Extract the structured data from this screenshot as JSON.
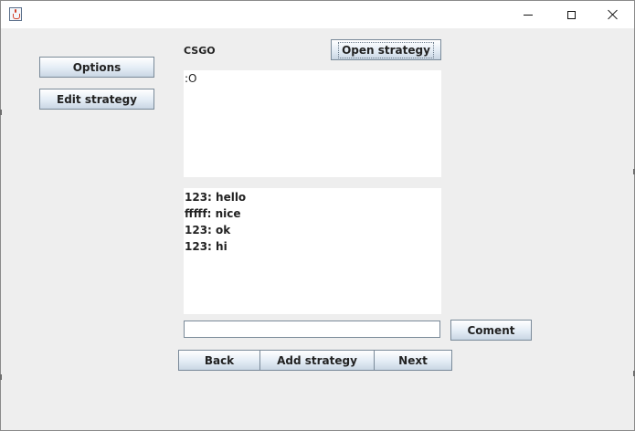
{
  "window": {
    "title": "",
    "controls": {
      "minimize": "minimize",
      "maximize": "maximize",
      "close": "close"
    }
  },
  "sidebar": {
    "options_label": "Options",
    "edit_strategy_label": "Edit strategy"
  },
  "strategy": {
    "game_name": "CSGO",
    "open_strategy_label": "Open strategy",
    "description": ":O"
  },
  "comments": [
    "123: hello",
    "fffff: nice",
    "123: ok",
    "123: hi"
  ],
  "comment_input": {
    "value": "",
    "button_label": "Coment"
  },
  "bottom_bar": {
    "back_label": "Back",
    "add_strategy_label": "Add strategy",
    "next_label": "Next"
  }
}
